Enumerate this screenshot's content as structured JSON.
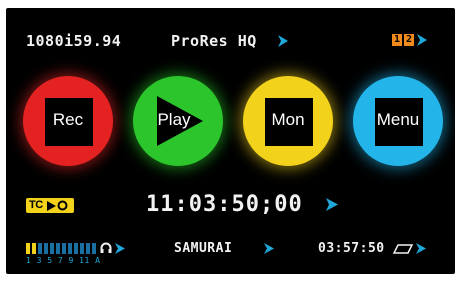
{
  "status": {
    "video_format": "1080i59.94",
    "codec": "ProRes HQ",
    "channel_1": "1",
    "channel_2": "2"
  },
  "buttons": {
    "rec": "Rec",
    "play": "Play",
    "mon": "Mon",
    "menu": "Menu"
  },
  "timecode": {
    "badge": "TC",
    "value": "11:03:50;00"
  },
  "footer": {
    "meter_labels": "1 3 5 7 9 11 A",
    "disk_name": "SAMURAI",
    "remaining_time": "03:57:50"
  },
  "colors": {
    "rec": "#e52222",
    "play": "#2cc52c",
    "mon": "#f2d21a",
    "menu": "#23b4ea",
    "accent_blue": "#1fa7d9",
    "badge_yellow": "#f2d21a",
    "channel_orange": "#f08a1c"
  },
  "icons": {
    "arrow": "chevron-right-icon",
    "headphones": "headphones-icon",
    "disk": "disk-icon"
  }
}
